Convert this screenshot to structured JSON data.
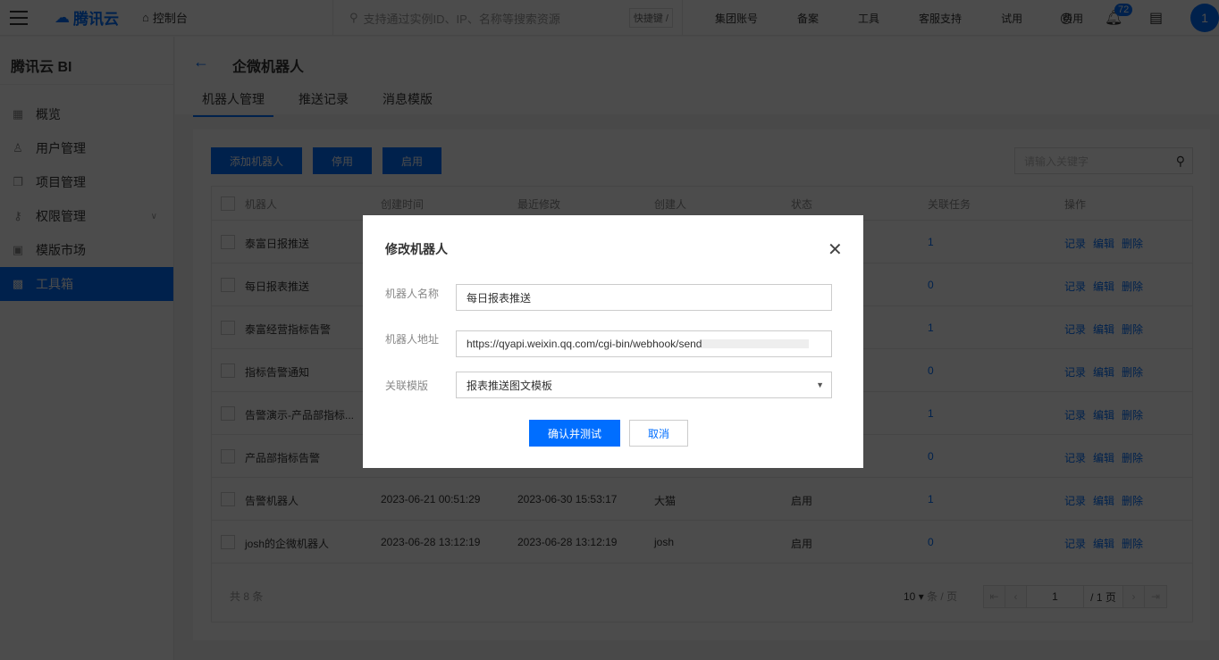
{
  "topbar": {
    "brand": "腾讯云",
    "console": "控制台",
    "search_placeholder": "支持通过实例ID、IP、名称等搜索资源",
    "shortcut": "快捷键 /",
    "links": [
      "集团账号",
      "备案",
      "工具",
      "客服支持",
      "试用",
      "费用"
    ],
    "notifications": "72",
    "avatar": "1"
  },
  "sidebar": {
    "title": "腾讯云 BI",
    "items": [
      {
        "label": "概览",
        "icon": "grid-icon"
      },
      {
        "label": "用户管理",
        "icon": "user-icon"
      },
      {
        "label": "项目管理",
        "icon": "copy-icon"
      },
      {
        "label": "权限管理",
        "icon": "key-icon"
      },
      {
        "label": "模版市场",
        "icon": "template-icon"
      },
      {
        "label": "工具箱",
        "icon": "toolbox-icon"
      }
    ]
  },
  "header": {
    "title": "企微机器人",
    "tabs": [
      "机器人管理",
      "推送记录",
      "消息模版"
    ]
  },
  "toolbar": {
    "add": "添加机器人",
    "disable": "停用",
    "enable": "启用",
    "search_placeholder": "请输入关键字"
  },
  "table": {
    "columns": [
      "机器人",
      "创建时间",
      "最近修改",
      "创建人",
      "状态",
      "关联任务",
      "操作"
    ],
    "rows": [
      {
        "name": "泰富日报推送",
        "created": "",
        "modified": "",
        "creator": "",
        "status": "",
        "tasks": "1"
      },
      {
        "name": "每日报表推送",
        "created": "",
        "modified": "",
        "creator": "",
        "status": "",
        "tasks": "0"
      },
      {
        "name": "泰富经营指标告警",
        "created": "",
        "modified": "",
        "creator": "",
        "status": "",
        "tasks": "1"
      },
      {
        "name": "指标告警通知",
        "created": "",
        "modified": "",
        "creator": "",
        "status": "",
        "tasks": "0"
      },
      {
        "name": "告警演示-产品部指标...",
        "created": "",
        "modified": "",
        "creator": "",
        "status": "",
        "tasks": "1"
      },
      {
        "name": "产品部指标告警",
        "created": "",
        "modified": "",
        "creator": "",
        "status": "",
        "tasks": "0"
      },
      {
        "name": "告警机器人",
        "created": "2023-06-21 00:51:29",
        "modified": "2023-06-30 15:53:17",
        "creator": "大猫",
        "status": "启用",
        "tasks": "1"
      },
      {
        "name": "josh的企微机器人",
        "created": "2023-06-28 13:12:19",
        "modified": "2023-06-28 13:12:19",
        "creator": "josh",
        "status": "启用",
        "tasks": "0"
      }
    ],
    "actions": [
      "记录",
      "编辑",
      "删除"
    ],
    "total": "共 8 条",
    "page_size": "10",
    "per_page": "条 / 页",
    "page": "1",
    "pages": "/ 1 页"
  },
  "modal": {
    "title": "修改机器人",
    "name_label": "机器人名称",
    "name_value": "每日报表推送",
    "url_label": "机器人地址",
    "url_value": "https://qyapi.weixin.qq.com/cgi-bin/webhook/send",
    "template_label": "关联模版",
    "template_value": "报表推送图文模板",
    "confirm": "确认并测试",
    "cancel": "取消"
  }
}
